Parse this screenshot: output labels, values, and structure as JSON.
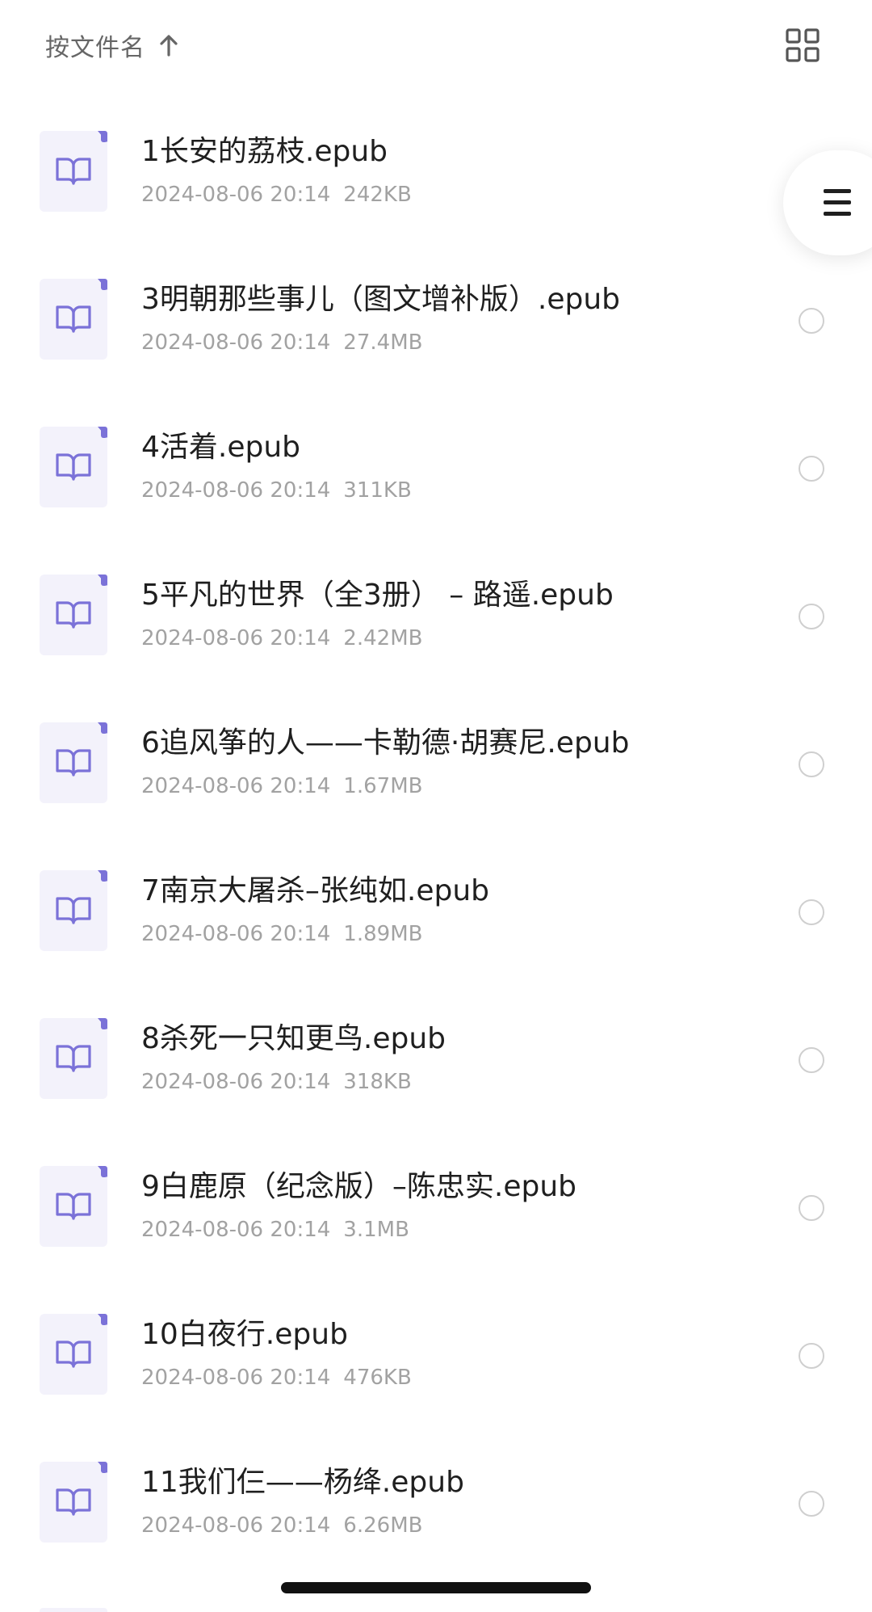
{
  "sort": {
    "label": "按文件名",
    "direction_icon": "arrow-up-icon"
  },
  "view_toggle": {
    "icon": "grid-view-icon"
  },
  "floating_menu": {
    "icon": "menu-icon"
  },
  "colors": {
    "accent": "#7b72d8",
    "icon_bg": "#f3f2fb",
    "title": "#1f1f1f",
    "meta": "#a2a2a2",
    "radio": "#cfcfcf"
  },
  "files": [
    {
      "name": "1长安的荔枝.epub",
      "date": "2024-08-06 20:14",
      "size": "242KB"
    },
    {
      "name": "3明朝那些事儿（图文增补版）.epub",
      "date": "2024-08-06 20:14",
      "size": "27.4MB"
    },
    {
      "name": "4活着.epub",
      "date": "2024-08-06 20:14",
      "size": "311KB"
    },
    {
      "name": "5平凡的世界（全3册） – 路遥.epub",
      "date": "2024-08-06 20:14",
      "size": "2.42MB"
    },
    {
      "name": "6追风筝的人——卡勒德·胡赛尼.epub",
      "date": "2024-08-06 20:14",
      "size": "1.67MB"
    },
    {
      "name": "7南京大屠杀–张纯如.epub",
      "date": "2024-08-06 20:14",
      "size": "1.89MB"
    },
    {
      "name": "8杀死一只知更鸟.epub",
      "date": "2024-08-06 20:14",
      "size": "318KB"
    },
    {
      "name": "9白鹿原（纪念版）–陈忠实.epub",
      "date": "2024-08-06 20:14",
      "size": "3.1MB"
    },
    {
      "name": "10白夜行.epub",
      "date": "2024-08-06 20:14",
      "size": "476KB"
    },
    {
      "name": "11我们仨——杨绛.epub",
      "date": "2024-08-06 20:14",
      "size": "6.26MB"
    }
  ]
}
